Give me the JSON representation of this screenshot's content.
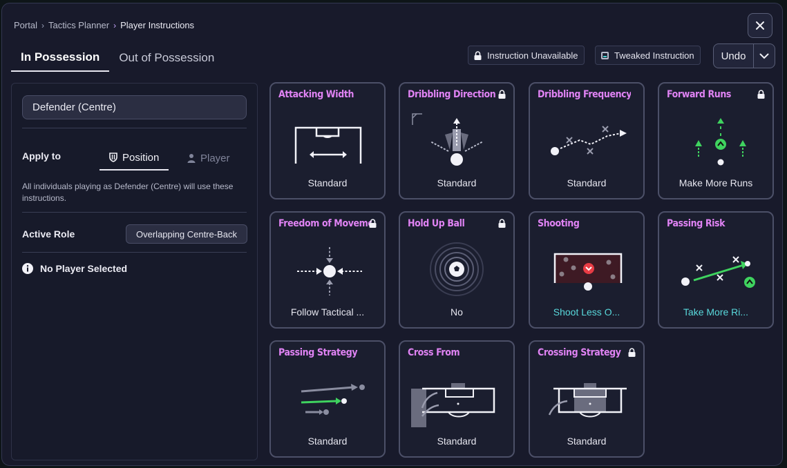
{
  "breadcrumb": [
    "Portal",
    "Tactics Planner",
    "Player Instructions"
  ],
  "tabs": [
    "In Possession",
    "Out of Possession"
  ],
  "legend": {
    "unavailable": "Instruction Unavailable",
    "tweaked": "Tweaked Instruction"
  },
  "undo_label": "Undo",
  "left": {
    "position": "Defender (Centre)",
    "apply_to": "Apply to",
    "apply_position": "Position",
    "apply_player": "Player",
    "description": "All individuals playing as Defender (Centre) will use these instructions.",
    "active_role_label": "Active Role",
    "active_role": "Overlapping Centre-Back",
    "no_player": "No Player Selected"
  },
  "colors": {
    "title": "#e083f4",
    "tweaked": "#59d9dc",
    "accent_green": "#3fd35f"
  },
  "cards": [
    {
      "title": "Attacking Width",
      "value": "Standard",
      "locked": false,
      "tweaked": false,
      "icon": "pitch-width-icon"
    },
    {
      "title": "Dribbling Direction",
      "value": "Standard",
      "locked": true,
      "tweaked": false,
      "icon": "dribble-direction-icon"
    },
    {
      "title": "Dribbling Frequency",
      "value": "Standard",
      "locked": false,
      "tweaked": false,
      "icon": "dribble-path-icon"
    },
    {
      "title": "Forward Runs",
      "value": "Make More Runs",
      "locked": true,
      "tweaked": false,
      "icon": "forward-runs-icon"
    },
    {
      "title": "Freedom of Movement",
      "value": "Follow Tactical ...",
      "locked": true,
      "tweaked": false,
      "icon": "freedom-icon"
    },
    {
      "title": "Hold Up Ball",
      "value": "No",
      "locked": true,
      "tweaked": false,
      "icon": "ball-rings-icon"
    },
    {
      "title": "Shooting",
      "value": "Shoot Less O...",
      "locked": false,
      "tweaked": true,
      "icon": "goal-shooting-icon"
    },
    {
      "title": "Passing Risk",
      "value": "Take More Ri...",
      "locked": false,
      "tweaked": true,
      "icon": "risky-pass-icon"
    },
    {
      "title": "Passing Strategy",
      "value": "Standard",
      "locked": false,
      "tweaked": false,
      "icon": "pass-arrows-icon"
    },
    {
      "title": "Cross From",
      "value": "Standard",
      "locked": false,
      "tweaked": false,
      "icon": "cross-from-icon"
    },
    {
      "title": "Crossing Strategy",
      "value": "Standard",
      "locked": true,
      "tweaked": false,
      "icon": "crossing-strategy-icon"
    }
  ]
}
